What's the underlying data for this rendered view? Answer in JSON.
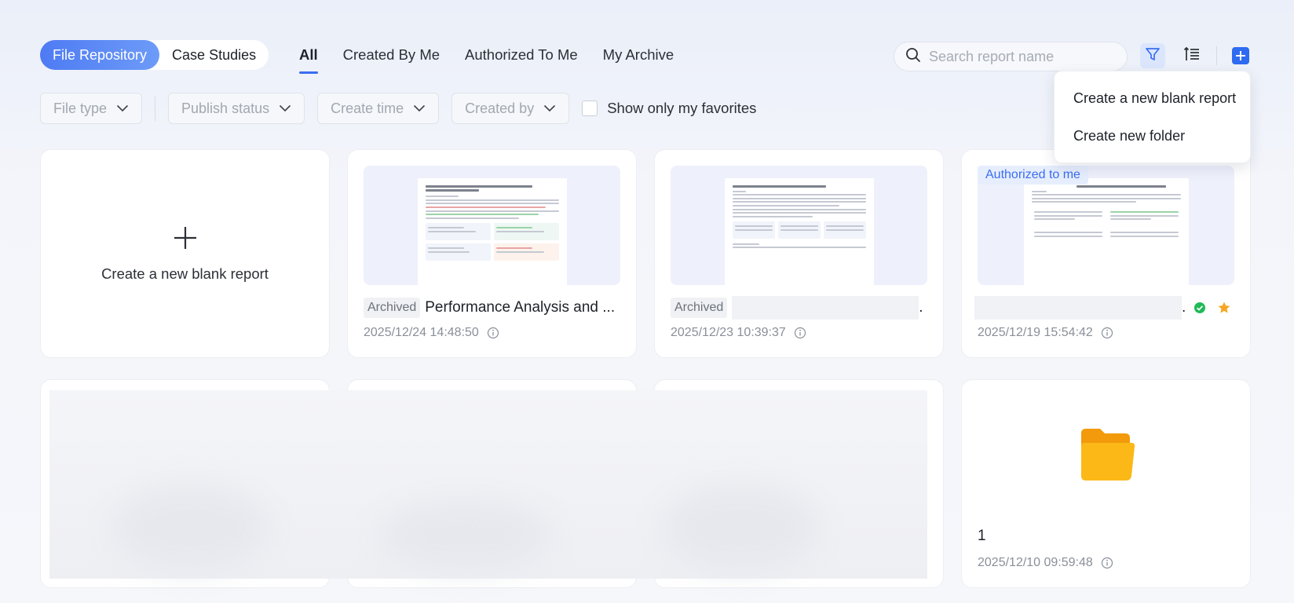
{
  "segmented": {
    "items": [
      "File Repository",
      "Case Studies"
    ],
    "active": "File Repository"
  },
  "tabs": {
    "items": [
      "All",
      "Created By Me",
      "Authorized To Me",
      "My Archive"
    ],
    "active": "All"
  },
  "search": {
    "placeholder": "Search report name"
  },
  "filters": {
    "file_type": "File type",
    "publish_status": "Publish status",
    "create_time": "Create time",
    "created_by": "Created by",
    "favorites": "Show only my favorites"
  },
  "create_menu": {
    "items": [
      "Create a new blank report",
      "Create new folder"
    ]
  },
  "new_card": {
    "label": "Create a new blank report"
  },
  "cards": [
    {
      "badge": "Archived",
      "title": "Performance Analysis and ...",
      "date": "2025/12/24 14:48:50"
    },
    {
      "badge": "Archived",
      "title": ".",
      "date": "2025/12/23 10:39:37"
    },
    {
      "tag": "Authorized to me",
      "title": ".",
      "date": "2025/12/19 15:54:42",
      "published": true,
      "favorite": true
    },
    {
      "type": "folder",
      "title": "1",
      "date": "2025/12/10 09:59:48"
    }
  ],
  "colors": {
    "accent": "#3b6df2",
    "folder": "#fbb817",
    "success": "#1fba57",
    "favorite": "#f5a623"
  }
}
